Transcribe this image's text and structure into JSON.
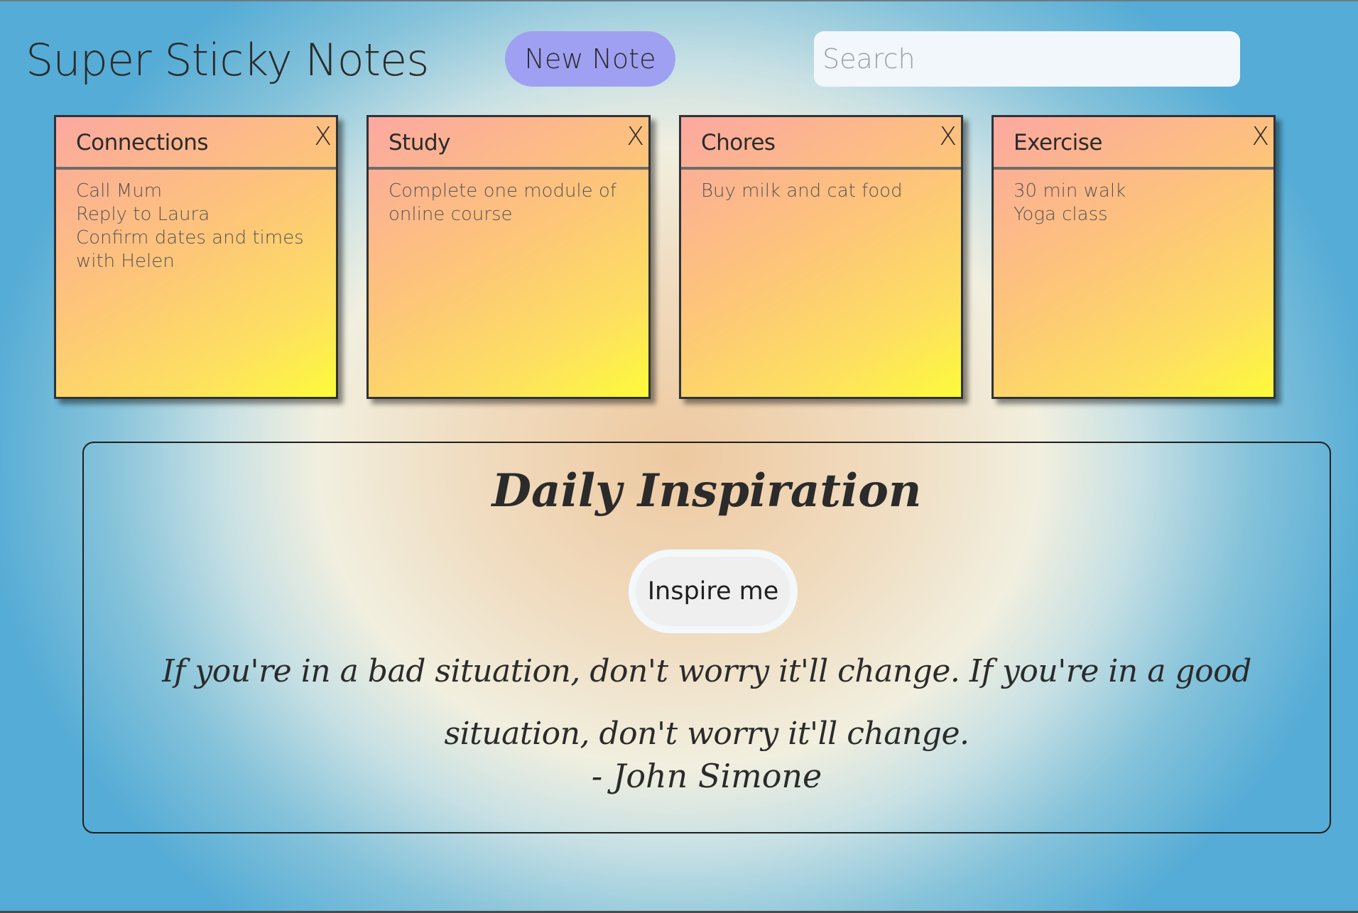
{
  "header": {
    "title": "Super Sticky Notes",
    "new_note_label": "New Note",
    "search_placeholder": "Search",
    "search_value": ""
  },
  "notes": [
    {
      "title": "Connections",
      "close_label": "X",
      "body": "Call Mum\nReply to Laura\nConfirm dates and times with Helen"
    },
    {
      "title": "Study",
      "close_label": "X",
      "body": "Complete one module of online course"
    },
    {
      "title": "Chores",
      "close_label": "X",
      "body": "Buy milk and cat food"
    },
    {
      "title": "Exercise",
      "close_label": "X",
      "body": "30 min walk\nYoga class"
    }
  ],
  "inspiration": {
    "title": "Daily Inspiration",
    "button_label": "Inspire me",
    "quote": "If you're in a bad situation, don't worry it'll change. If you're in a good situation, don't worry it'll change.",
    "author": "- John Simone"
  },
  "colors": {
    "new_note_button": "#9fa0f2",
    "note_gradient_start": "#fca8a0",
    "note_gradient_end": "#fdfb3a",
    "background_edge": "#55acd6",
    "background_center": "#eec9a0"
  }
}
